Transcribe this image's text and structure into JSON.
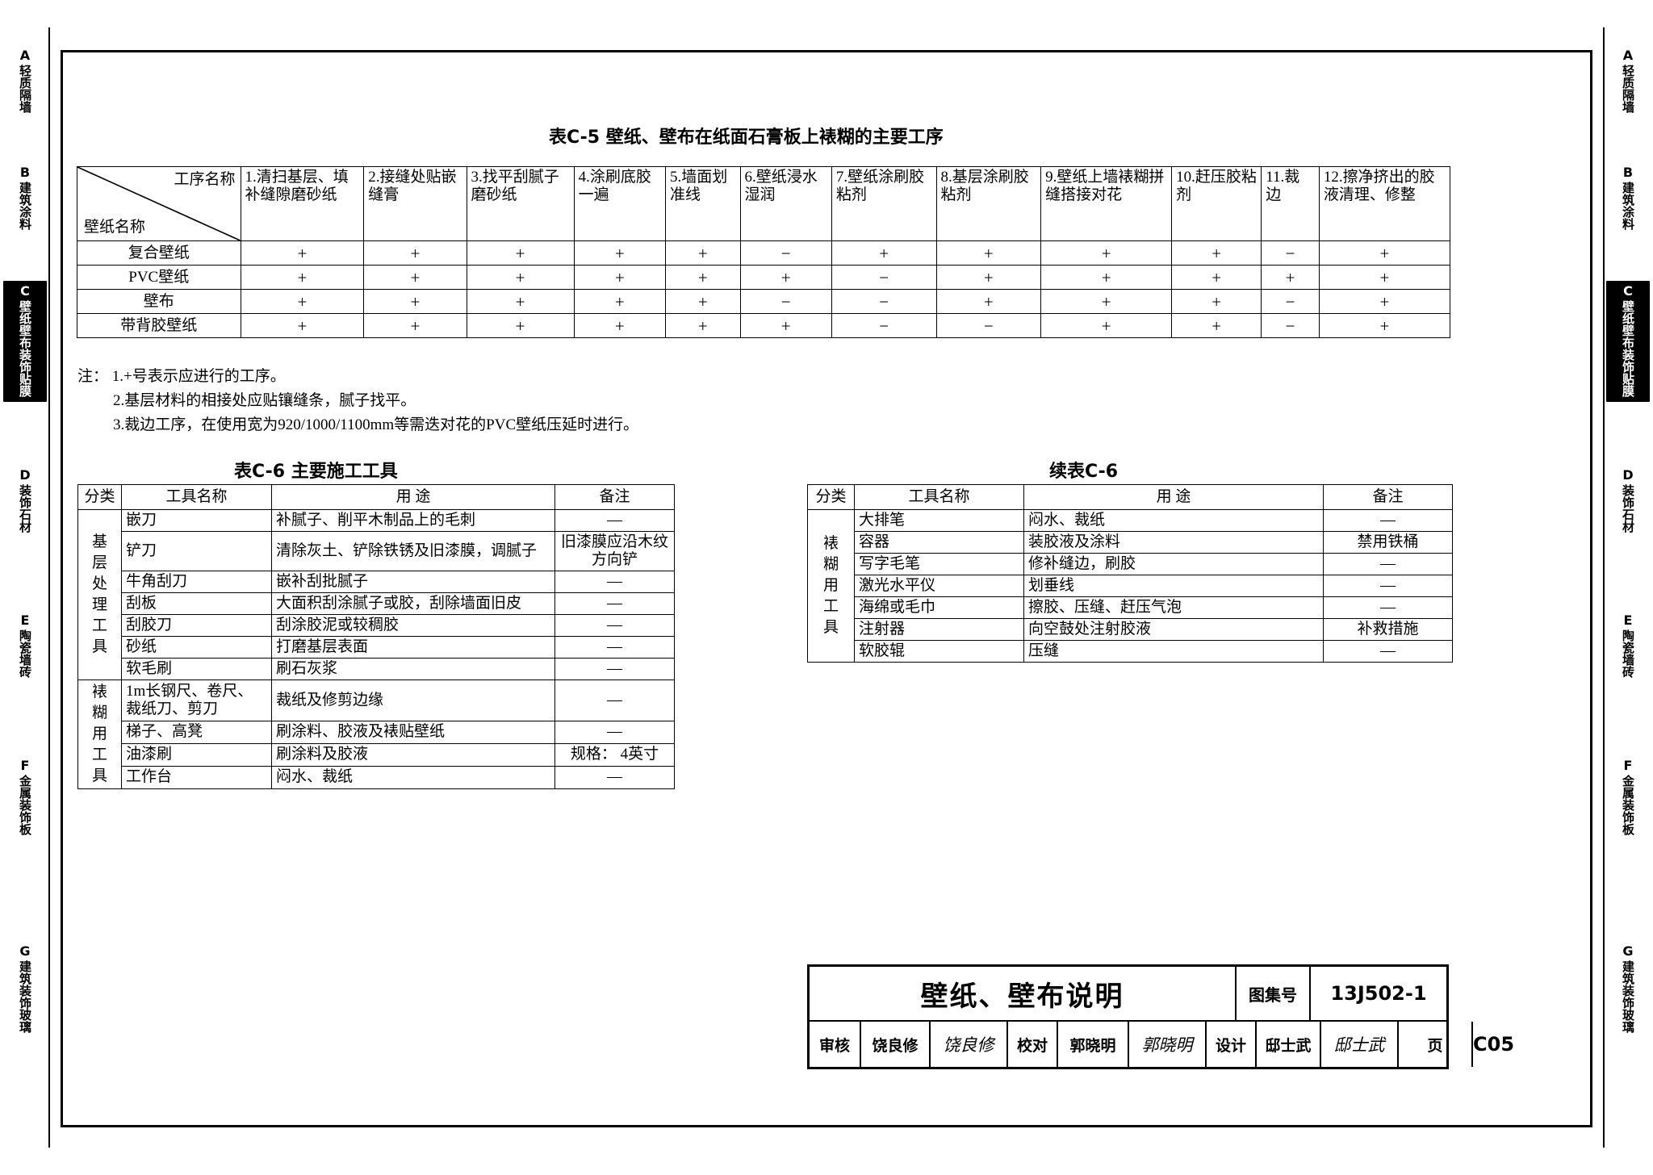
{
  "side_index": {
    "items": [
      {
        "letter": "A",
        "label": "轻质隔墙",
        "active": false
      },
      {
        "letter": "B",
        "label": "建筑涂料",
        "active": false
      },
      {
        "letter": "C",
        "label": "壁纸壁布装饰贴膜",
        "active": true
      },
      {
        "letter": "D",
        "label": "装饰石材",
        "active": false
      },
      {
        "letter": "E",
        "label": "陶瓷墙砖",
        "active": false
      },
      {
        "letter": "F",
        "label": "金属装饰板",
        "active": false
      },
      {
        "letter": "G",
        "label": "建筑装饰玻璃",
        "active": false
      }
    ]
  },
  "table_c5": {
    "title": "表C-5 壁纸、壁布在纸面石膏板上裱糊的主要工序",
    "corner_top": "工序名称",
    "corner_bottom": "壁纸名称",
    "columns": [
      "1.清扫基层、填补缝隙磨砂纸",
      "2.接缝处贴嵌缝膏",
      "3.找平刮腻子磨砂纸",
      "4.涂刷底胶一遍",
      "5.墙面划准线",
      "6.壁纸浸水湿润",
      "7.壁纸涂刷胶粘剂",
      "8.基层涂刷胶粘剂",
      "9.壁纸上墙裱糊拼缝搭接对花",
      "10.赶压胶粘剂",
      "11.裁边",
      "12.擦净挤出的胶液清理、修整"
    ],
    "rows": [
      {
        "name": "复合壁纸",
        "marks": [
          "+",
          "+",
          "+",
          "+",
          "+",
          "−",
          "+",
          "+",
          "+",
          "+",
          "−",
          "+"
        ]
      },
      {
        "name": "PVC壁纸",
        "marks": [
          "+",
          "+",
          "+",
          "+",
          "+",
          "+",
          "−",
          "+",
          "+",
          "+",
          "+",
          "+"
        ]
      },
      {
        "name": "壁布",
        "marks": [
          "+",
          "+",
          "+",
          "+",
          "+",
          "−",
          "−",
          "+",
          "+",
          "+",
          "−",
          "+"
        ]
      },
      {
        "name": "带背胶壁纸",
        "marks": [
          "+",
          "+",
          "+",
          "+",
          "+",
          "+",
          "−",
          "−",
          "+",
          "+",
          "−",
          "+"
        ]
      }
    ],
    "notes": [
      "注： 1.+号表示应进行的工序。",
      "2.基层材料的相接处应贴镶缝条，腻子找平。",
      "3.裁边工序，在使用宽为920/1000/1100mm等需迭对花的PVC壁纸压延时进行。"
    ]
  },
  "table_c6": {
    "title": "表C-6 主要施工工具",
    "headers": [
      "分类",
      "工具名称",
      "用  途",
      "备注"
    ],
    "groups": [
      {
        "category": "基层处理工具",
        "rows": [
          {
            "tool": "嵌刀",
            "use": "补腻子、削平木制品上的毛刺",
            "remark": "—"
          },
          {
            "tool": "铲刀",
            "use": "清除灰土、铲除铁锈及旧漆膜，调腻子",
            "remark": "旧漆膜应沿木纹方向铲"
          },
          {
            "tool": "牛角刮刀",
            "use": "嵌补刮批腻子",
            "remark": "—"
          },
          {
            "tool": "刮板",
            "use": "大面积刮涂腻子或胶，刮除墙面旧皮",
            "remark": "—"
          },
          {
            "tool": "刮胶刀",
            "use": "刮涂胶泥或较稠胶",
            "remark": "—"
          },
          {
            "tool": "砂纸",
            "use": "打磨基层表面",
            "remark": "—"
          },
          {
            "tool": "软毛刷",
            "use": "刷石灰浆",
            "remark": "—"
          }
        ]
      },
      {
        "category": "裱糊用工具",
        "rows": [
          {
            "tool": "1m长钢尺、卷尺、裁纸刀、剪刀",
            "use": "裁纸及修剪边缘",
            "remark": "—"
          },
          {
            "tool": "梯子、高凳",
            "use": "刷涂料、胶液及裱贴壁纸",
            "remark": "—"
          },
          {
            "tool": "油漆刷",
            "use": "刷涂料及胶液",
            "remark": "规格： 4英寸"
          },
          {
            "tool": "工作台",
            "use": "闷水、裁纸",
            "remark": "—"
          }
        ]
      }
    ]
  },
  "table_c6_cont": {
    "title": "续表C-6",
    "headers": [
      "分类",
      "工具名称",
      "用  途",
      "备注"
    ],
    "groups": [
      {
        "category": "裱糊用工具",
        "rows": [
          {
            "tool": "大排笔",
            "use": "闷水、裁纸",
            "remark": "—"
          },
          {
            "tool": "容器",
            "use": "装胶液及涂料",
            "remark": "禁用铁桶"
          },
          {
            "tool": "写字毛笔",
            "use": "修补缝边，刷胶",
            "remark": "—"
          },
          {
            "tool": "激光水平仪",
            "use": "划垂线",
            "remark": "—"
          },
          {
            "tool": "海绵或毛巾",
            "use": "擦胶、压缝、赶压气泡",
            "remark": "—"
          },
          {
            "tool": "注射器",
            "use": "向空鼓处注射胶液",
            "remark": "补救措施"
          },
          {
            "tool": "软胶辊",
            "use": "压缝",
            "remark": "—"
          }
        ]
      }
    ]
  },
  "title_block": {
    "drawing_name": "壁纸、壁布说明",
    "atlas_label": "图集号",
    "atlas_value": "13J502-1",
    "page_label": "页",
    "page_value": "C05",
    "review_label": "审核",
    "review_name": "饶良修",
    "review_sign": "饶良修",
    "check_label": "校对",
    "check_name": "郭晓明",
    "check_sign": "郭晓明",
    "design_label": "设计",
    "design_name": "邸士武",
    "design_sign": "邸士武"
  }
}
